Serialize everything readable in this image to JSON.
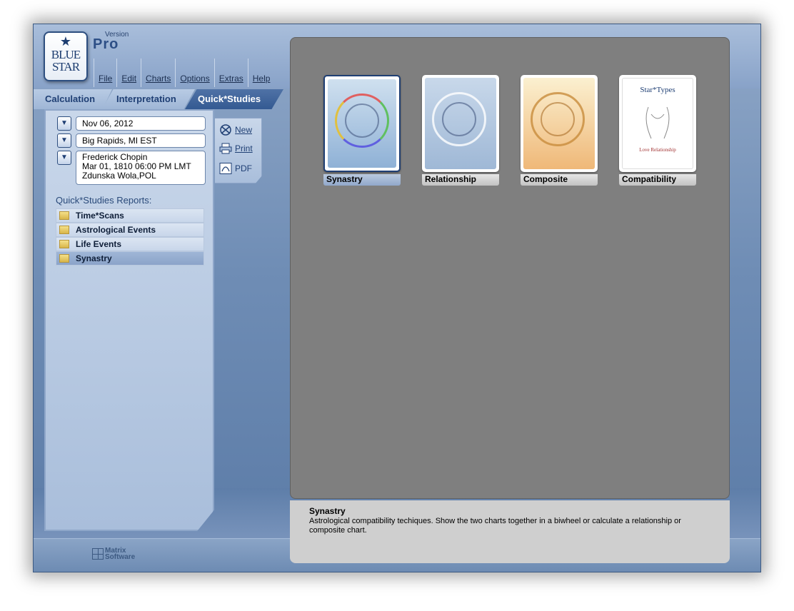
{
  "app": {
    "logo_line1": "BLUE",
    "logo_line2": "STAR",
    "version_label": "Version",
    "edition": "Pro"
  },
  "menu": [
    "File",
    "Edit",
    "Charts",
    "Options",
    "Extras",
    "Help"
  ],
  "tabs": [
    "Calculation",
    "Interpretation",
    "Quick*Studies"
  ],
  "active_tab": "Quick*Studies",
  "selectors": {
    "date": "Nov 06, 2012",
    "location": "Big Rapids, MI EST",
    "chart_line1": "Frederick Chopin",
    "chart_line2": "Mar 01, 1810  06:00 PM LMT",
    "chart_line3": "Zdunska Wola,POL"
  },
  "actions": {
    "new_label": "New",
    "print_label": "Print",
    "pdf_label": "PDF"
  },
  "reports": {
    "title": "Quick*Studies Reports:",
    "items": [
      "Time*Scans",
      "Astrological Events",
      "Life Events",
      "Synastry"
    ],
    "selected": "Synastry"
  },
  "thumbnails": [
    {
      "label": "Synastry",
      "selected": true
    },
    {
      "label": "Relationship",
      "selected": false
    },
    {
      "label": "Composite",
      "selected": false
    },
    {
      "label": "Compatibility",
      "selected": false,
      "cover_title": "Star*Types",
      "cover_sub": "Love Relationship"
    }
  ],
  "description": {
    "title": "Synastry",
    "body": "Astrological compatibility techiques. Show the two charts together in a biwheel or calculate a relationship or composite chart."
  },
  "company": {
    "line1": "Matrix",
    "line2": "Software"
  },
  "colors": {
    "accent": "#1f3f74",
    "content_bg": "#7f7f7f",
    "desc_bg": "#cfcfcf"
  }
}
